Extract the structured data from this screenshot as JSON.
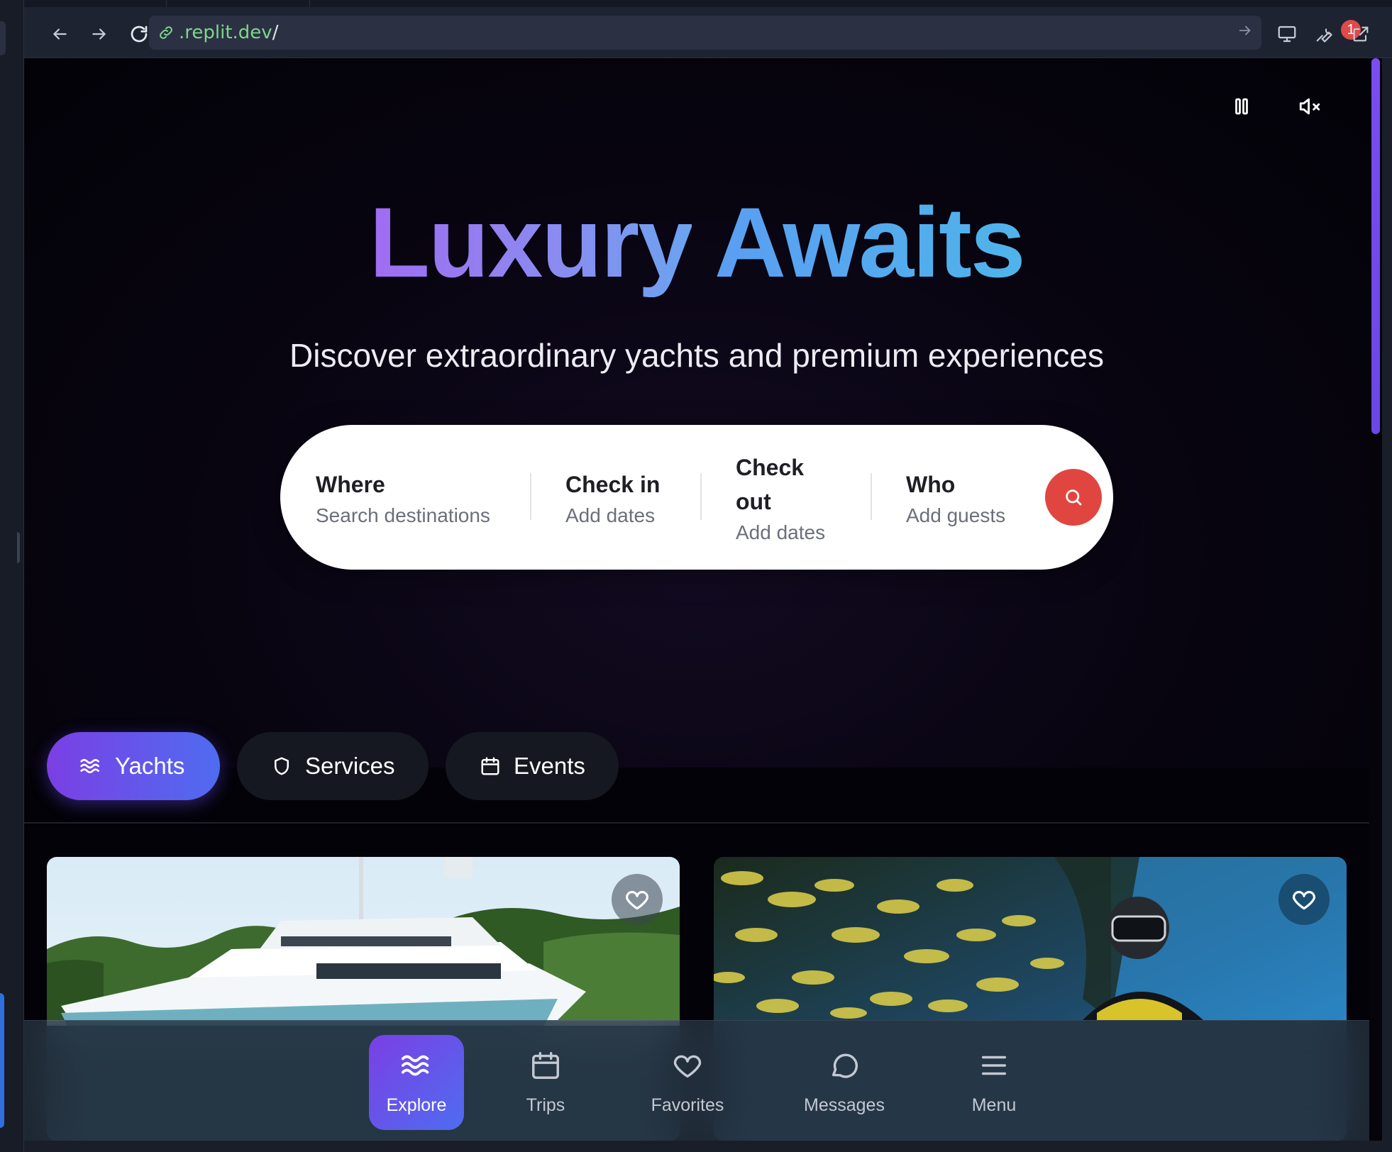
{
  "browser": {
    "url_host": ".replit.dev",
    "url_path": "/",
    "devtools_badge": "1"
  },
  "hero": {
    "title_word1": "Luxury",
    "title_word2": "Awaits",
    "subtitle": "Discover extraordinary yachts and premium experiences"
  },
  "search": {
    "where_label": "Where",
    "where_placeholder": "Search destinations",
    "checkin_label": "Check in",
    "checkin_placeholder": "Add dates",
    "checkout_label_line1": "Check",
    "checkout_label_line2": "out",
    "checkout_placeholder": "Add dates",
    "who_label": "Who",
    "who_placeholder": "Add guests"
  },
  "categories": [
    {
      "label": "Yachts",
      "icon": "waves-icon",
      "active": true
    },
    {
      "label": "Services",
      "icon": "shield-icon",
      "active": false
    },
    {
      "label": "Events",
      "icon": "calendar-icon",
      "active": false
    }
  ],
  "bottom_nav": [
    {
      "label": "Explore",
      "icon": "waves-icon",
      "active": true
    },
    {
      "label": "Trips",
      "icon": "calendar-icon",
      "active": false
    },
    {
      "label": "Favorites",
      "icon": "heart-icon",
      "active": false
    },
    {
      "label": "Messages",
      "icon": "message-icon",
      "active": false
    },
    {
      "label": "Menu",
      "icon": "menu-icon",
      "active": false
    }
  ],
  "colors": {
    "accent_purple": "#7b3fe4",
    "accent_blue": "#4f6cf0",
    "search_button": "#e0463f",
    "background": "#030208"
  }
}
